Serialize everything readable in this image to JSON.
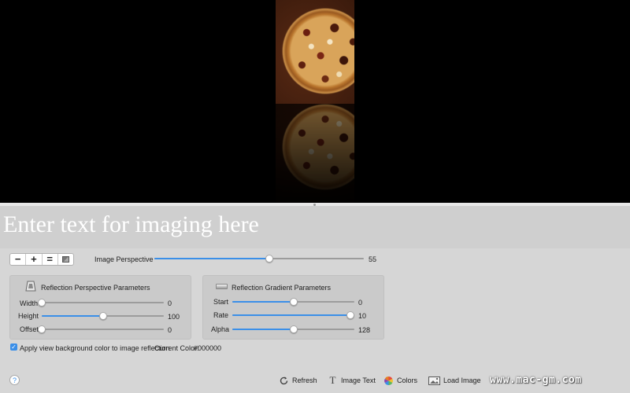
{
  "text_entry": {
    "placeholder": "Enter text for imaging here",
    "value": ""
  },
  "zoom_control": {
    "zoom_out_label": "−",
    "zoom_in_label": "+",
    "actual_size_label": "=",
    "fit_icon": "fit-to-window-icon"
  },
  "image_perspective": {
    "label": "Image Perspective",
    "value": "55",
    "min": 0,
    "max": 100,
    "level": 55
  },
  "reflection_perspective": {
    "title": "Reflection Perspective Parameters",
    "icon": "perspective-icon",
    "width": {
      "label": "Width",
      "value": "0",
      "min": 0,
      "max": 100,
      "level": 0
    },
    "height": {
      "label": "Height",
      "value": "100",
      "min": 0,
      "max": 200,
      "level": 100
    },
    "offset": {
      "label": "Offset",
      "value": "0",
      "min": 0,
      "max": 100,
      "level": 0
    }
  },
  "reflection_gradient": {
    "title": "Reflection Gradient Parameters",
    "icon": "gradient-icon",
    "start": {
      "label": "Start",
      "value": "0",
      "min": -100,
      "max": 100,
      "level": 0
    },
    "rate": {
      "label": "Rate",
      "value": "10",
      "min": 0,
      "max": 10,
      "level": 10
    },
    "alpha": {
      "label": "Alpha",
      "value": "128",
      "min": 0,
      "max": 255,
      "level": 128
    }
  },
  "background_option": {
    "label": "Apply view background color to image reflection",
    "checked": true
  },
  "current_color": {
    "label": "Current Color:",
    "value": "#000000"
  },
  "toolbar": {
    "help_label": "?",
    "refresh_label": "Refresh",
    "image_text_label": "Image Text",
    "image_text_glyph": "T",
    "colors_label": "Colors",
    "load_image_label": "Load Image"
  },
  "watermark": "www.mac-gm.com",
  "colors": {
    "accent": "#3b8fe8",
    "preview_background": "#000000",
    "panel_background": "#d6d6d6"
  }
}
